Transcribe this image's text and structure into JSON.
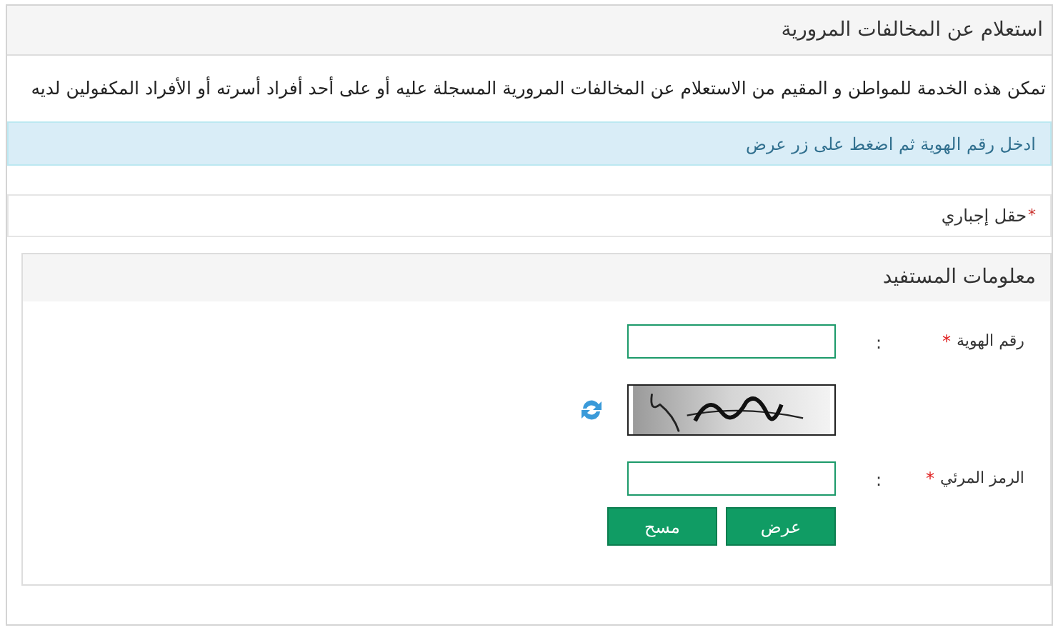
{
  "panel": {
    "title": "استعلام عن المخالفات المرورية"
  },
  "description": "تمكن هذه الخدمة للمواطن و المقيم من الاستعلام عن المخالفات المرورية المسجلة عليه أو على أحد أفراد أسرته أو الأفراد المكفولين لديه",
  "info": "ادخل رقم الهوية ثم اضغط على زر عرض",
  "required_note": {
    "mark": "*",
    "text": "حقل إجباري"
  },
  "section": {
    "title": "معلومات المستفيد",
    "rows": [
      {
        "kind": "input",
        "label": "رقم الهوية",
        "required_mark": "*",
        "colon": ":"
      },
      {
        "kind": "captcha"
      },
      {
        "kind": "input",
        "label": "الرمز المرئي",
        "required_mark": "*",
        "colon": ":"
      }
    ],
    "buttons": [
      "عرض",
      "مسح"
    ]
  }
}
